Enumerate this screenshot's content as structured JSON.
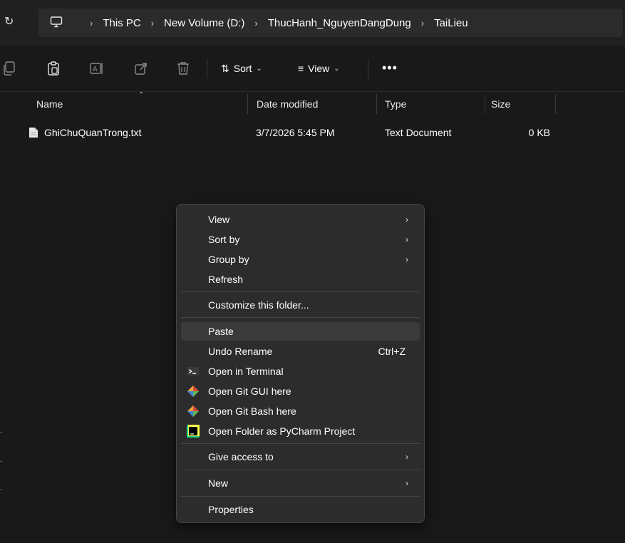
{
  "address": {
    "breadcrumbs": [
      "This PC",
      "New Volume (D:)",
      "ThucHanh_NguyenDangDung",
      "TaiLieu"
    ],
    "separator": "›"
  },
  "toolbar": {
    "sort_label": "Sort",
    "view_label": "View",
    "more_label": "•••"
  },
  "columns": {
    "name": "Name",
    "date": "Date modified",
    "type": "Type",
    "size": "Size"
  },
  "files": [
    {
      "name": "GhiChuQuanTrong.txt",
      "date": "3/7/2026 5:45 PM",
      "type": "Text Document",
      "size": "0 KB"
    }
  ],
  "context_menu": {
    "items": [
      {
        "label": "View"
      },
      {
        "label": "Sort by"
      },
      {
        "label": "Group by"
      },
      {
        "label": "Refresh"
      },
      {
        "label": "Customize this folder..."
      },
      {
        "label": "Paste"
      },
      {
        "label": "Undo Rename",
        "shortcut": "Ctrl+Z"
      },
      {
        "label": "Open in Terminal",
        "icon": "terminal-icon"
      },
      {
        "label": "Open Git GUI here",
        "icon": "git-icon"
      },
      {
        "label": "Open Git Bash here",
        "icon": "git-icon"
      },
      {
        "label": "Open Folder as PyCharm Project",
        "icon": "pycharm-icon"
      },
      {
        "label": "Give access to"
      },
      {
        "label": "New"
      },
      {
        "label": "Properties"
      }
    ],
    "submenu_arrow": "›"
  },
  "colors": {
    "background": "#191919",
    "menu_background": "#2c2c2c",
    "hover": "#3a3a3a",
    "text": "#ffffff"
  }
}
